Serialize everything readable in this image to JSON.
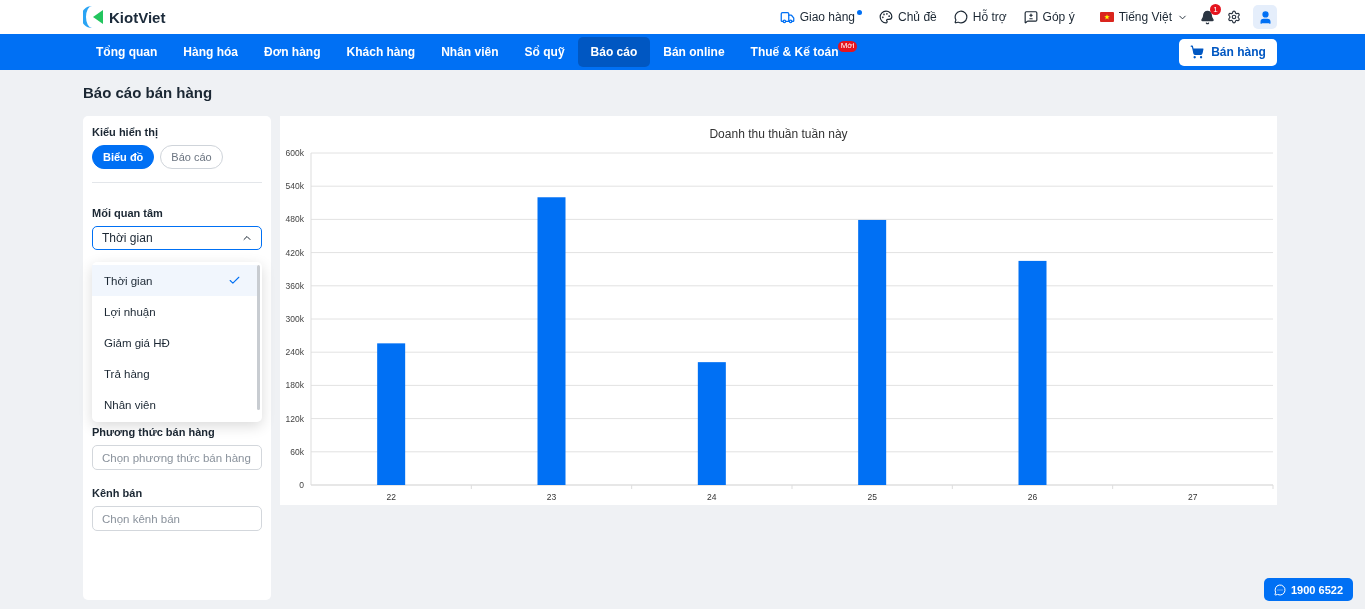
{
  "brand": "KiotViet",
  "top_links": [
    {
      "kind": "delivery",
      "label": "Giao hàng",
      "dot": true
    },
    {
      "kind": "theme",
      "label": "Chủ đề",
      "dot": false
    },
    {
      "kind": "help",
      "label": "Hỗ trợ",
      "dot": false
    },
    {
      "kind": "feedback",
      "label": "Góp ý",
      "dot": false
    }
  ],
  "language": "Tiếng Việt",
  "notification_count": "1",
  "nav": [
    {
      "label": "Tổng quan",
      "selected": false
    },
    {
      "label": "Hàng hóa",
      "selected": false
    },
    {
      "label": "Đơn hàng",
      "selected": false
    },
    {
      "label": "Khách hàng",
      "selected": false
    },
    {
      "label": "Nhân viên",
      "selected": false
    },
    {
      "label": "Sổ quỹ",
      "selected": false
    },
    {
      "label": "Báo cáo",
      "selected": true
    },
    {
      "label": "Bán online",
      "selected": false
    },
    {
      "label": "Thuế & Kế toán",
      "selected": false,
      "badge": "Mới"
    }
  ],
  "sell_button": "Bán hàng",
  "page_title": "Báo cáo bán hàng",
  "filters": {
    "display_label": "Kiểu hiển thị",
    "display_options": [
      {
        "label": "Biểu đồ",
        "selected": true
      },
      {
        "label": "Báo cáo",
        "selected": false
      }
    ],
    "concern_label": "Mối quan tâm",
    "concern_value": "Thời gian",
    "concern_options": [
      {
        "label": "Thời gian",
        "selected": true
      },
      {
        "label": "Lợi nhuận",
        "selected": false
      },
      {
        "label": "Giảm giá HĐ",
        "selected": false
      },
      {
        "label": "Trả hàng",
        "selected": false
      },
      {
        "label": "Nhân viên",
        "selected": false
      }
    ],
    "method_label": "Phương thức bán hàng",
    "method_placeholder": "Chọn phương thức bán hàng",
    "channel_label": "Kênh bán",
    "channel_placeholder": "Chọn kênh bán"
  },
  "chart_data": {
    "type": "bar",
    "title": "Doanh thu thuần tuần này",
    "categories": [
      "22",
      "23",
      "24",
      "25",
      "26",
      "27"
    ],
    "values": [
      256000,
      520000,
      222000,
      479000,
      405000,
      null
    ],
    "grid": true,
    "ylim": [
      0,
      600000
    ],
    "yticks": [
      {
        "value": 0,
        "label": "0"
      },
      {
        "value": 60000,
        "label": "60k"
      },
      {
        "value": 120000,
        "label": "120k"
      },
      {
        "value": 180000,
        "label": "180k"
      },
      {
        "value": 240000,
        "label": "240k"
      },
      {
        "value": 300000,
        "label": "300k"
      },
      {
        "value": 360000,
        "label": "360k"
      },
      {
        "value": 420000,
        "label": "420k"
      },
      {
        "value": 480000,
        "label": "480k"
      },
      {
        "value": 540000,
        "label": "540k"
      },
      {
        "value": 600000,
        "label": "600k"
      }
    ]
  },
  "hotline": "1900 6522"
}
